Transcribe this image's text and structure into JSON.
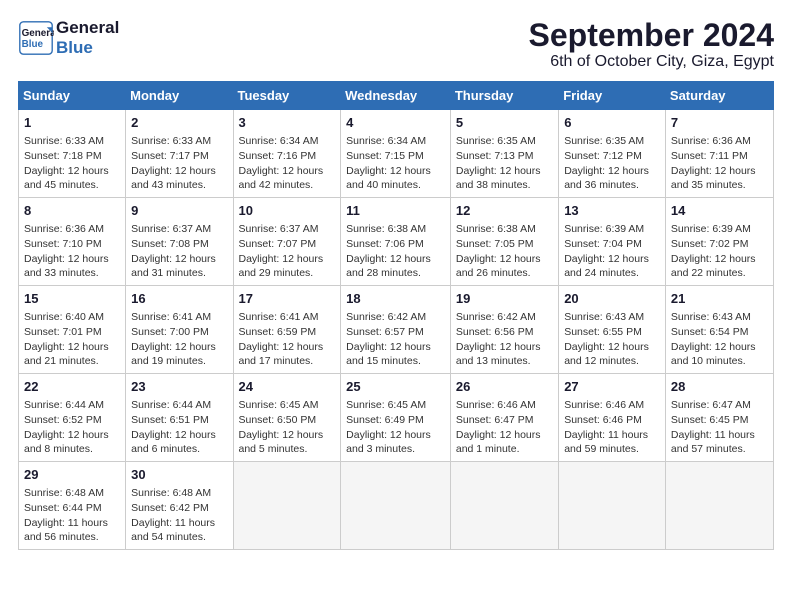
{
  "header": {
    "logo_general": "General",
    "logo_blue": "Blue",
    "title": "September 2024",
    "subtitle": "6th of October City, Giza, Egypt"
  },
  "calendar": {
    "days_of_week": [
      "Sunday",
      "Monday",
      "Tuesday",
      "Wednesday",
      "Thursday",
      "Friday",
      "Saturday"
    ],
    "weeks": [
      [
        {
          "day": "1",
          "info": "Sunrise: 6:33 AM\nSunset: 7:18 PM\nDaylight: 12 hours\nand 45 minutes."
        },
        {
          "day": "2",
          "info": "Sunrise: 6:33 AM\nSunset: 7:17 PM\nDaylight: 12 hours\nand 43 minutes."
        },
        {
          "day": "3",
          "info": "Sunrise: 6:34 AM\nSunset: 7:16 PM\nDaylight: 12 hours\nand 42 minutes."
        },
        {
          "day": "4",
          "info": "Sunrise: 6:34 AM\nSunset: 7:15 PM\nDaylight: 12 hours\nand 40 minutes."
        },
        {
          "day": "5",
          "info": "Sunrise: 6:35 AM\nSunset: 7:13 PM\nDaylight: 12 hours\nand 38 minutes."
        },
        {
          "day": "6",
          "info": "Sunrise: 6:35 AM\nSunset: 7:12 PM\nDaylight: 12 hours\nand 36 minutes."
        },
        {
          "day": "7",
          "info": "Sunrise: 6:36 AM\nSunset: 7:11 PM\nDaylight: 12 hours\nand 35 minutes."
        }
      ],
      [
        {
          "day": "8",
          "info": "Sunrise: 6:36 AM\nSunset: 7:10 PM\nDaylight: 12 hours\nand 33 minutes."
        },
        {
          "day": "9",
          "info": "Sunrise: 6:37 AM\nSunset: 7:08 PM\nDaylight: 12 hours\nand 31 minutes."
        },
        {
          "day": "10",
          "info": "Sunrise: 6:37 AM\nSunset: 7:07 PM\nDaylight: 12 hours\nand 29 minutes."
        },
        {
          "day": "11",
          "info": "Sunrise: 6:38 AM\nSunset: 7:06 PM\nDaylight: 12 hours\nand 28 minutes."
        },
        {
          "day": "12",
          "info": "Sunrise: 6:38 AM\nSunset: 7:05 PM\nDaylight: 12 hours\nand 26 minutes."
        },
        {
          "day": "13",
          "info": "Sunrise: 6:39 AM\nSunset: 7:04 PM\nDaylight: 12 hours\nand 24 minutes."
        },
        {
          "day": "14",
          "info": "Sunrise: 6:39 AM\nSunset: 7:02 PM\nDaylight: 12 hours\nand 22 minutes."
        }
      ],
      [
        {
          "day": "15",
          "info": "Sunrise: 6:40 AM\nSunset: 7:01 PM\nDaylight: 12 hours\nand 21 minutes."
        },
        {
          "day": "16",
          "info": "Sunrise: 6:41 AM\nSunset: 7:00 PM\nDaylight: 12 hours\nand 19 minutes."
        },
        {
          "day": "17",
          "info": "Sunrise: 6:41 AM\nSunset: 6:59 PM\nDaylight: 12 hours\nand 17 minutes."
        },
        {
          "day": "18",
          "info": "Sunrise: 6:42 AM\nSunset: 6:57 PM\nDaylight: 12 hours\nand 15 minutes."
        },
        {
          "day": "19",
          "info": "Sunrise: 6:42 AM\nSunset: 6:56 PM\nDaylight: 12 hours\nand 13 minutes."
        },
        {
          "day": "20",
          "info": "Sunrise: 6:43 AM\nSunset: 6:55 PM\nDaylight: 12 hours\nand 12 minutes."
        },
        {
          "day": "21",
          "info": "Sunrise: 6:43 AM\nSunset: 6:54 PM\nDaylight: 12 hours\nand 10 minutes."
        }
      ],
      [
        {
          "day": "22",
          "info": "Sunrise: 6:44 AM\nSunset: 6:52 PM\nDaylight: 12 hours\nand 8 minutes."
        },
        {
          "day": "23",
          "info": "Sunrise: 6:44 AM\nSunset: 6:51 PM\nDaylight: 12 hours\nand 6 minutes."
        },
        {
          "day": "24",
          "info": "Sunrise: 6:45 AM\nSunset: 6:50 PM\nDaylight: 12 hours\nand 5 minutes."
        },
        {
          "day": "25",
          "info": "Sunrise: 6:45 AM\nSunset: 6:49 PM\nDaylight: 12 hours\nand 3 minutes."
        },
        {
          "day": "26",
          "info": "Sunrise: 6:46 AM\nSunset: 6:47 PM\nDaylight: 12 hours\nand 1 minute."
        },
        {
          "day": "27",
          "info": "Sunrise: 6:46 AM\nSunset: 6:46 PM\nDaylight: 11 hours\nand 59 minutes."
        },
        {
          "day": "28",
          "info": "Sunrise: 6:47 AM\nSunset: 6:45 PM\nDaylight: 11 hours\nand 57 minutes."
        }
      ],
      [
        {
          "day": "29",
          "info": "Sunrise: 6:48 AM\nSunset: 6:44 PM\nDaylight: 11 hours\nand 56 minutes."
        },
        {
          "day": "30",
          "info": "Sunrise: 6:48 AM\nSunset: 6:42 PM\nDaylight: 11 hours\nand 54 minutes."
        },
        {
          "day": "",
          "info": ""
        },
        {
          "day": "",
          "info": ""
        },
        {
          "day": "",
          "info": ""
        },
        {
          "day": "",
          "info": ""
        },
        {
          "day": "",
          "info": ""
        }
      ]
    ]
  }
}
